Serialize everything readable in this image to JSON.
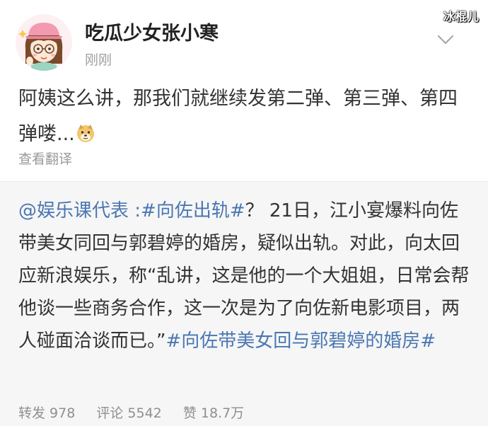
{
  "watermark": "冰棍儿",
  "post": {
    "username": "吃瓜少女张小寒",
    "time": "刚刚",
    "text": "阿姨这么讲，那我们就继续发第二弹、第三弹、第四弹喽...",
    "translate_label": "查看翻译",
    "emoji_icon": "doge-icon"
  },
  "repost": {
    "mention": "@娱乐课代表",
    "separator": " :",
    "hashtag1": "#向佐出轨#",
    "body": "？ 21日，江小宴爆料向佐带美女同回与郭碧婷的婚房，疑似出轨。对此，向太回应新浪娱乐，称“乱讲，这是他的一个大姐姐，日常会帮他谈一些商务合作，这一次是为了向佐新电影项目，两人碰面洽谈而已。”",
    "hashtag2": "#向佐带美女回与郭碧婷的婚房#",
    "stats": {
      "repost": "转发 978",
      "comment": "评论 5542",
      "like": "赞 18.7万"
    }
  }
}
